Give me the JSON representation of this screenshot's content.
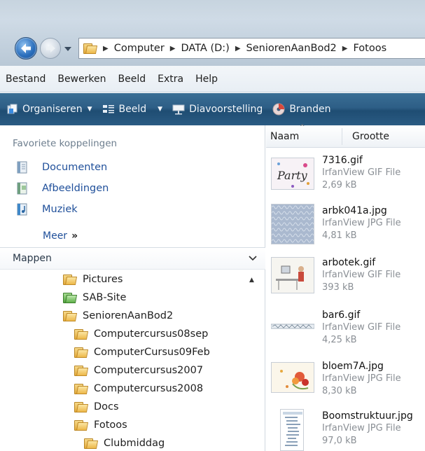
{
  "address": {
    "crumbs": [
      "Computer",
      "DATA (D:)",
      "SeniorenAanBod2",
      "Fotoos"
    ]
  },
  "menu": [
    "Bestand",
    "Bewerken",
    "Beeld",
    "Extra",
    "Help"
  ],
  "commands": {
    "organiseren": "Organiseren",
    "beeld": "Beeld",
    "diavoorstelling": "Diavoorstelling",
    "branden": "Branden"
  },
  "favorites": {
    "title": "Favoriete koppelingen",
    "items": [
      "Documenten",
      "Afbeeldingen",
      "Muziek"
    ],
    "more": "Meer",
    "more_glyph": "»"
  },
  "folders": {
    "title": "Mappen",
    "items": [
      {
        "label": "Pictures",
        "color": "yellow"
      },
      {
        "label": "SAB-Site",
        "color": "green"
      },
      {
        "label": "SeniorenAanBod2",
        "color": "yellow"
      },
      {
        "label": "Computercursus08sep",
        "color": "yellow"
      },
      {
        "label": "ComputerCursus09Feb",
        "color": "yellow"
      },
      {
        "label": "Computercursus2007",
        "color": "yellow"
      },
      {
        "label": "Computercursus2008",
        "color": "yellow"
      },
      {
        "label": "Docs",
        "color": "yellow"
      },
      {
        "label": "Fotoos",
        "color": "yellow"
      },
      {
        "label": "Clubmiddag",
        "color": "yellow"
      }
    ]
  },
  "filelist": {
    "col_name": "Naam",
    "col_size": "Grootte",
    "files": [
      {
        "name": "7316.gif",
        "type": "IrfanView GIF File",
        "size": "2,69 kB"
      },
      {
        "name": "arbk041a.jpg",
        "type": "IrfanView JPG File",
        "size": "4,81 kB"
      },
      {
        "name": "arbotek.gif",
        "type": "IrfanView GIF File",
        "size": "393 kB"
      },
      {
        "name": "bar6.gif",
        "type": "IrfanView GIF File",
        "size": "4,25 kB"
      },
      {
        "name": "bloem7A.jpg",
        "type": "IrfanView JPG File",
        "size": "8,30 kB"
      },
      {
        "name": "Boomstruktuur.jpg",
        "type": "IrfanView JPG File",
        "size": "97,0 kB"
      }
    ]
  },
  "thumb_labels": {
    "party": "Party"
  },
  "colors": {
    "link_blue": "#1f4f9a",
    "command_bar": "#2d5e86",
    "folder_yellow": "#edb84a",
    "folder_green": "#5fb04a"
  }
}
